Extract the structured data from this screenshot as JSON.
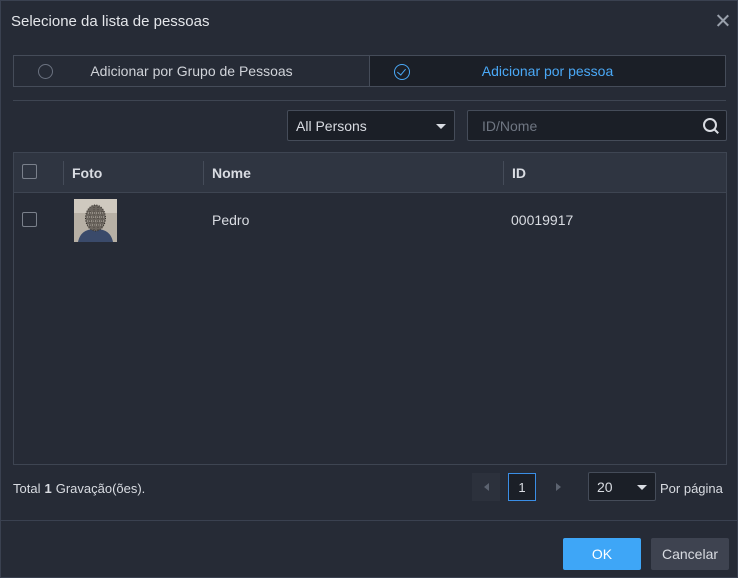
{
  "dialog": {
    "title": "Selecione da lista de pessoas"
  },
  "mode": {
    "group_label": "Adicionar por Grupo de Pessoas",
    "person_label": "Adicionar por pessoa",
    "selected": "person"
  },
  "filter": {
    "select_value": "All Persons",
    "search_placeholder": "ID/Nome",
    "search_value": ""
  },
  "table": {
    "headers": {
      "photo": "Foto",
      "name": "Nome",
      "id": "ID"
    },
    "rows": [
      {
        "name": "Pedro",
        "id": "00019917",
        "checked": false
      }
    ]
  },
  "pagination": {
    "total_label": "Total",
    "total_count": "1",
    "records_label": "Gravação(ões).",
    "current_page": "1",
    "page_size": "20",
    "per_page_label": "Por página"
  },
  "buttons": {
    "ok": "OK",
    "cancel": "Cancelar"
  },
  "colors": {
    "accent": "#3ea6f7",
    "background": "#262b36",
    "active_tab_text": "#4aa9f7"
  },
  "icons": [
    "close-icon",
    "radio-empty-icon",
    "radio-checked-icon",
    "dropdown-caret-icon",
    "search-icon",
    "chevron-left-icon",
    "chevron-right-icon",
    "person-photo"
  ]
}
